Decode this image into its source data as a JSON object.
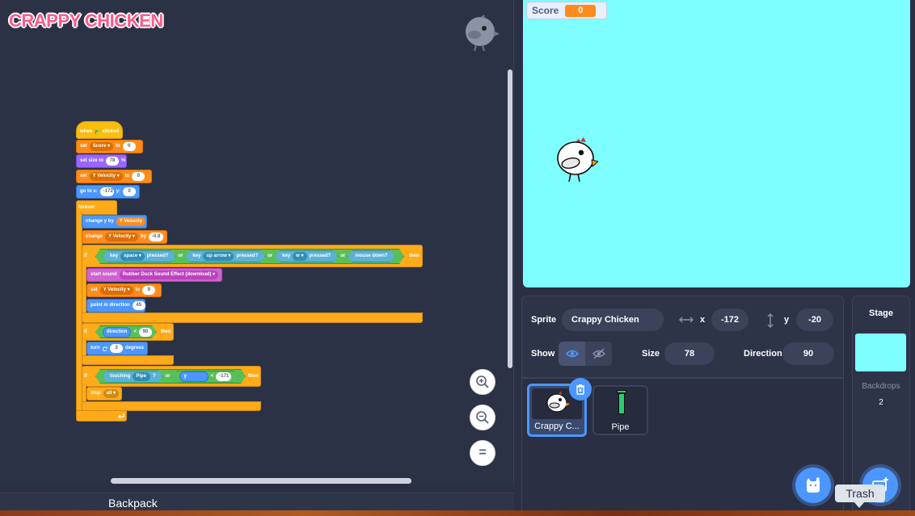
{
  "project": {
    "title": "CRAPPY CHICKEN"
  },
  "script": {
    "when_flag": {
      "when": "when",
      "clicked": "clicked"
    },
    "set_score": {
      "set": "set",
      "var": "Score",
      "to": "to",
      "value": "0"
    },
    "set_size": {
      "label": "set size to",
      "value": "78",
      "unit": "%"
    },
    "set_yvel": {
      "set": "set",
      "var": "Y Velocity",
      "to": "to",
      "value": "0"
    },
    "goto": {
      "label": "go to x:",
      "x": "-172",
      "ylabel": "y:",
      "y": "0"
    },
    "forever": "forever",
    "change_y": {
      "label": "change y by",
      "var": "Y Velocity"
    },
    "change_var": {
      "label": "change",
      "var": "Y Velocity",
      "by": "by",
      "value": "-0.8"
    },
    "if1": {
      "if": "if",
      "key": "key",
      "k1": "space",
      "pressed": "pressed?",
      "or": "or",
      "k2": "up arrow",
      "k3": "w",
      "mouse": "mouse down?",
      "then": "then"
    },
    "start_sound": {
      "label": "start sound",
      "sound": "Rubber Duck Sound Effect (download)"
    },
    "set_yvel2": {
      "set": "set",
      "var": "Y Velocity",
      "to": "to",
      "value": "9"
    },
    "point_dir": {
      "label": "point in direction",
      "value": "45"
    },
    "if2": {
      "if": "if",
      "lhs": "direction",
      "op": "<",
      "value": "90",
      "then": "then"
    },
    "turn": {
      "label": "turn",
      "value": "3",
      "unit": "degrees"
    },
    "if3": {
      "if": "if",
      "touching": "touching",
      "target": "Pipe",
      "q": "?",
      "or": "or",
      "ypos": "y position",
      "op": "<",
      "value": "-171",
      "then": "then"
    },
    "stop": {
      "label": "stop",
      "value": "all"
    }
  },
  "zoom": {
    "in": "zoom-in-icon",
    "out": "zoom-out-icon",
    "reset": "="
  },
  "backpack": {
    "label": "Backpack"
  },
  "stage": {
    "background_color": "#7ffeff"
  },
  "monitor": {
    "label": "Score",
    "value": "0"
  },
  "sprite_info": {
    "sprite_label": "Sprite",
    "sprite_name": "Crappy Chicken",
    "x_label": "x",
    "x": "-172",
    "y_label": "y",
    "y": "-20",
    "show_label": "Show",
    "size_label": "Size",
    "size": "78",
    "direction_label": "Direction",
    "direction": "90"
  },
  "sprites": [
    {
      "name": "Crappy C...",
      "selected": true
    },
    {
      "name": "Pipe",
      "selected": false
    }
  ],
  "stage_panel": {
    "title": "Stage",
    "backdrops_label": "Backdrops",
    "backdrops_count": "2"
  },
  "tooltip": {
    "label": "Trash"
  },
  "colors": {
    "accent": "#4c97ff",
    "events": "#f8bd0e",
    "variables": "#ff8c1a",
    "control": "#ffab19"
  }
}
